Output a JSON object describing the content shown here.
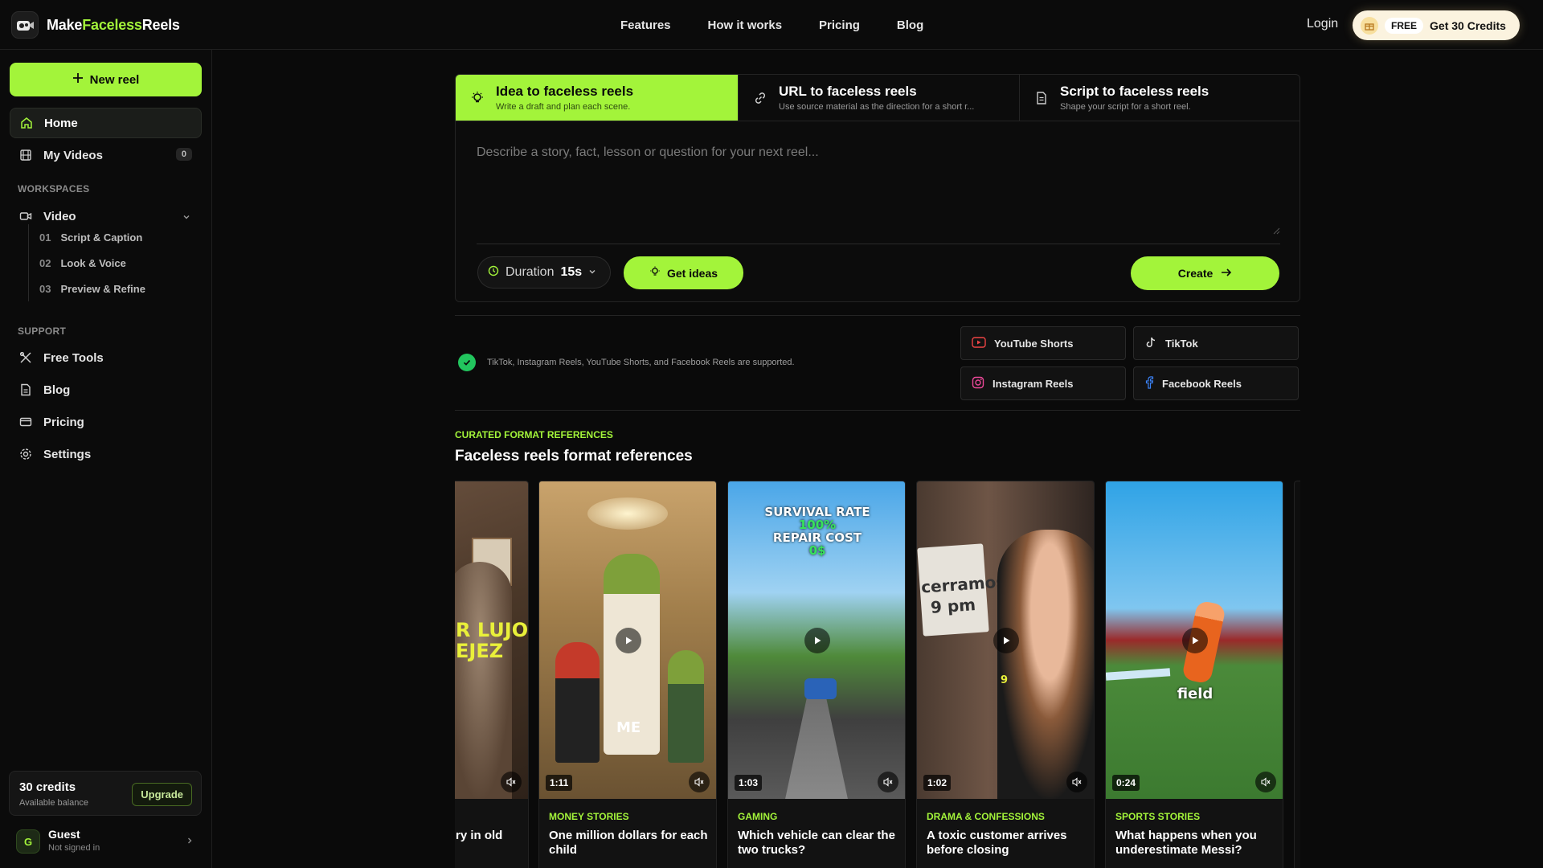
{
  "brand": {
    "prefix": "Make",
    "accent": "Faceless",
    "suffix": "Reels"
  },
  "topnav": {
    "items": [
      "Features",
      "How it works",
      "Pricing",
      "Blog"
    ],
    "login": "Login",
    "free_badge": "FREE",
    "credits_cta": "Get 30 Credits"
  },
  "sidebar": {
    "new_reel": "New reel",
    "home": "Home",
    "my_videos": "My Videos",
    "my_videos_count": "0",
    "workspaces_label": "WORKSPACES",
    "video": "Video",
    "steps": [
      {
        "num": "01",
        "label": "Script & Caption"
      },
      {
        "num": "02",
        "label": "Look & Voice"
      },
      {
        "num": "03",
        "label": "Preview & Refine"
      }
    ],
    "support_label": "SUPPORT",
    "free_tools": "Free Tools",
    "blog": "Blog",
    "pricing": "Pricing",
    "settings": "Settings",
    "credits": {
      "amount": "30 credits",
      "label": "Available balance",
      "upgrade": "Upgrade"
    },
    "user": {
      "initial": "G",
      "name": "Guest",
      "status": "Not signed in"
    }
  },
  "composer": {
    "tabs": [
      {
        "title": "Idea to faceless reels",
        "subtitle": "Write a draft and plan each scene."
      },
      {
        "title": "URL to faceless reels",
        "subtitle": "Use source material as the direction for a short r..."
      },
      {
        "title": "Script to faceless reels",
        "subtitle": "Shape your script for a short reel."
      }
    ],
    "placeholder": "Describe a story, fact, lesson or question for your next reel...",
    "duration_label": "Duration",
    "duration_value": "15s",
    "get_ideas": "Get ideas",
    "create": "Create"
  },
  "platforms": {
    "supported_text": "TikTok, Instagram Reels, YouTube Shorts, and Facebook Reels are supported.",
    "items": [
      "YouTube Shorts",
      "TikTok",
      "Instagram Reels",
      "Facebook Reels"
    ]
  },
  "references": {
    "eyebrow": "CURATED FORMAT REFERENCES",
    "title": "Faceless reels format references",
    "cards": [
      {
        "category": "",
        "title": "ry in old",
        "duration": "",
        "overlay": [
          "R LUJO",
          "EJEZ"
        ]
      },
      {
        "category": "MONEY STORIES",
        "title": "One million dollars for each child",
        "duration": "1:11",
        "overlay": [
          "ME"
        ]
      },
      {
        "category": "GAMING",
        "title": "Which vehicle can clear the two trucks?",
        "duration": "1:03",
        "overlay": [
          "SURVIVAL RATE",
          "100%",
          "REPAIR COST",
          "0$"
        ]
      },
      {
        "category": "DRAMA & CONFESSIONS",
        "title": "A toxic customer arrives before closing",
        "duration": "1:02",
        "overlay": [
          "cerramos",
          "9 pm",
          "9"
        ]
      },
      {
        "category": "SPORTS STORIES",
        "title": "What happens when you underestimate Messi?",
        "duration": "0:24",
        "overlay": [
          "field"
        ]
      }
    ]
  },
  "colors": {
    "accent": "#a3f43a",
    "background": "#0a0a0a",
    "check": "#22c55e"
  }
}
